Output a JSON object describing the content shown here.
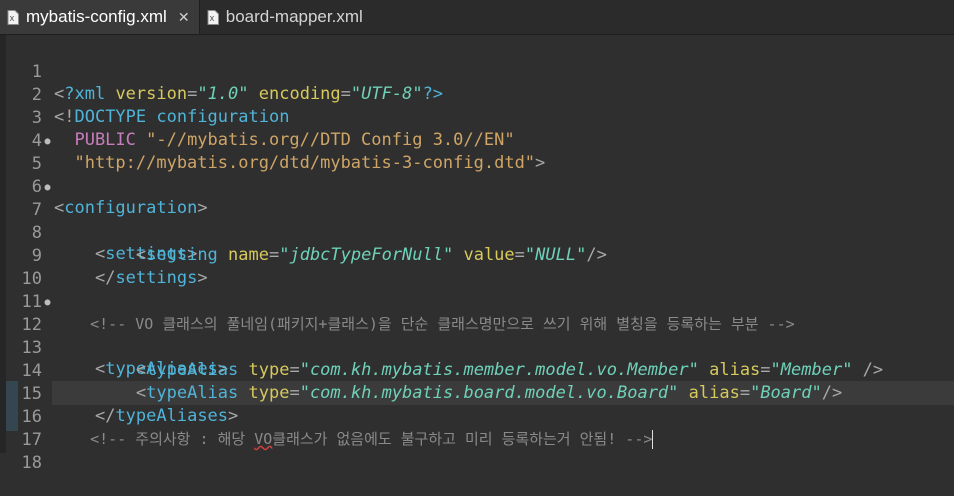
{
  "tabs": [
    {
      "label": "mybatis-config.xml",
      "close": "✕"
    },
    {
      "label": "board-mapper.xml"
    }
  ],
  "lines": {
    "l1": {
      "n": "1",
      "v1": "?xml ",
      "a1": "version",
      "e1": "=",
      "s1": "\"1.0\"",
      "a2": " encoding",
      "e2": "=",
      "s2": "\"UTF-8\"",
      "end": "?>"
    },
    "l2": {
      "n": "2",
      "open": "<!",
      "kw": "DOCTYPE",
      "name": " configuration"
    },
    "l3": {
      "n": "3",
      "kw": "  PUBLIC ",
      "str": "\"-//mybatis.org//DTD Config 3.0//EN\""
    },
    "l4": {
      "n": "4",
      "str": "  \"http://mybatis.org/dtd/mybatis-3-config.dtd\"",
      "end": ">"
    },
    "l5": {
      "n": "5",
      "open": "<",
      "tag": "configuration",
      "close": ">"
    },
    "l6": {
      "n": "6"
    },
    "l7": {
      "n": "7",
      "indent": "    ",
      "open": "<",
      "tag": "settings",
      "close": ">"
    },
    "l8": {
      "n": "8",
      "indent": "        ",
      "open": "<",
      "tag": "setting",
      "a1": " name",
      "e1": "=",
      "s1": "\"jdbcTypeForNull\"",
      "a2": " value",
      "e2": "=",
      "s2": "\"NULL\"",
      "close": "/>"
    },
    "l9": {
      "n": "9",
      "indent": "    ",
      "open": "</",
      "tag": "settings",
      "close": ">"
    },
    "l10": {
      "n": "10"
    },
    "l11": {
      "n": "11",
      "text": "    <!-- VO 클래스의 풀네임(패키지+클래스)을 단순 클래스명만으로 쓰기 위해 별칭을 등록하는 부분 -->"
    },
    "l12": {
      "n": "12",
      "indent": "    ",
      "open": "<",
      "tag": "typeAliases",
      "close": ">"
    },
    "l13": {
      "n": "13",
      "indent": "        ",
      "open": "<",
      "tag": "typeAlias",
      "a1": " type",
      "e1": "=",
      "s1": "\"com.kh.mybatis.member.model.vo.Member\"",
      "a2": " alias",
      "e2": "=",
      "s2": "\"Member\"",
      "close": " />"
    },
    "l14": {
      "n": "14",
      "indent": "        ",
      "open": "<",
      "tag": "typeAlias",
      "a1": " type",
      "e1": "=",
      "s1": "\"com.kh.mybatis.board.model.vo.Board\"",
      "a2": " alias",
      "e2": "=",
      "s2": "\"Board\"",
      "close": "/>"
    },
    "l15": {
      "n": "15",
      "indent": "    ",
      "open": "</",
      "tag": "typeAliases",
      "close": ">"
    },
    "l16": {
      "n": "16",
      "indent": "    ",
      "pre": "<!-- 주의사항 : 해당 ",
      "sq": "VO",
      "post": "클래스가 없음에도 불구하고 미리 등록하는거 안됨! -->"
    },
    "l17": {
      "n": "17"
    },
    "l18": {
      "n": "18"
    }
  },
  "colors": {
    "tag": "#4fb4d8",
    "attr": "#d7c95c",
    "value": "#6fd1b8",
    "comment": "#8a8a8a",
    "doctype_string": "#cfa566",
    "keyword": "#c77dbb"
  }
}
